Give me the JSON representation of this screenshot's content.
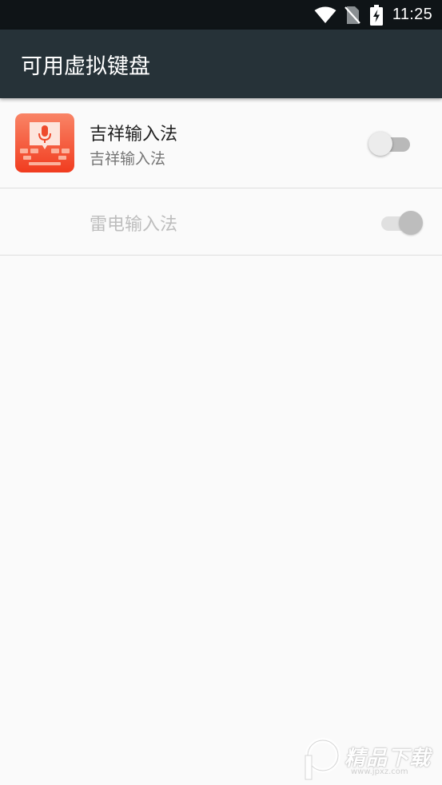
{
  "status_bar": {
    "time": "11:25",
    "icons": [
      "wifi-icon",
      "no-sim-icon",
      "battery-charging-icon"
    ]
  },
  "app_bar": {
    "title": "可用虚拟键盘"
  },
  "keyboards": [
    {
      "title": "吉祥输入法",
      "summary": "吉祥输入法",
      "icon": "jixiang-keyboard-app-icon",
      "enabled": false,
      "disabled": false
    },
    {
      "title": "雷电输入法",
      "summary": "",
      "icon": "",
      "enabled": true,
      "disabled": true
    }
  ],
  "watermark": {
    "text": "精品下载",
    "sub": "www.jpxz.com"
  },
  "colors": {
    "status_bar": "#0f1417",
    "app_bar": "#263238",
    "background": "#fafafa",
    "app_icon_accent": "#f4502f"
  }
}
